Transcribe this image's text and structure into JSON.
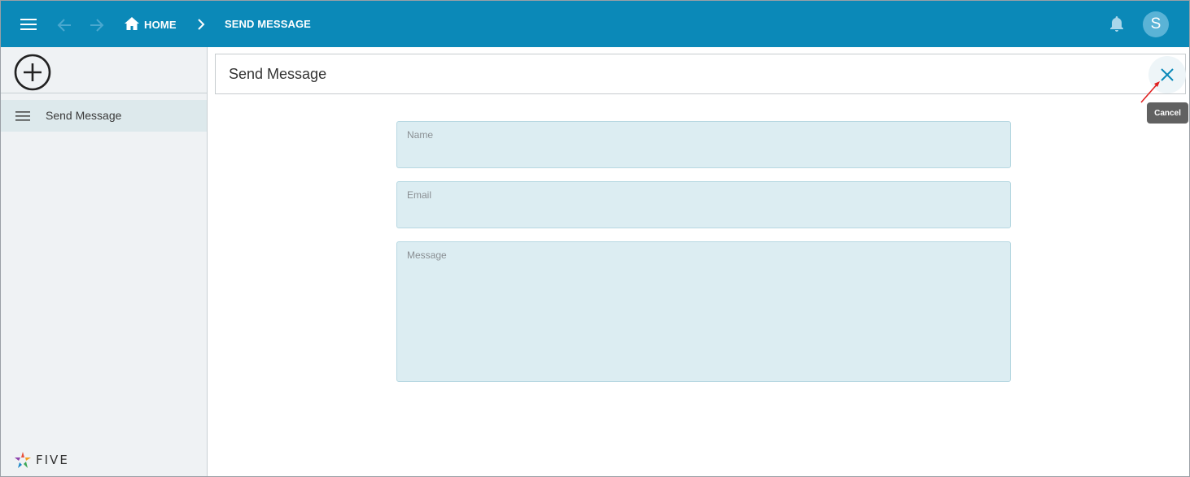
{
  "topbar": {
    "breadcrumb_home": "HOME",
    "breadcrumb_current": "SEND MESSAGE",
    "avatar_initial": "S",
    "icons": [
      "menu-icon",
      "back-arrow-icon",
      "forward-arrow-icon",
      "home-icon",
      "chevron-right-icon",
      "bell-icon"
    ],
    "background_color": "#0b89b8"
  },
  "sidebar": {
    "add_icon": "plus-circle-icon",
    "items": [
      {
        "label": "Send Message",
        "icon": "list-icon",
        "selected": true
      }
    ],
    "logo_text": "FIVE"
  },
  "main": {
    "title": "Send Message",
    "close_tooltip": "Cancel",
    "fields": {
      "name": {
        "label": "Name",
        "value": ""
      },
      "email": {
        "label": "Email",
        "value": ""
      },
      "message": {
        "label": "Message",
        "value": ""
      }
    },
    "field_background": "#dcedf2",
    "accent_color": "#0b89b8"
  }
}
